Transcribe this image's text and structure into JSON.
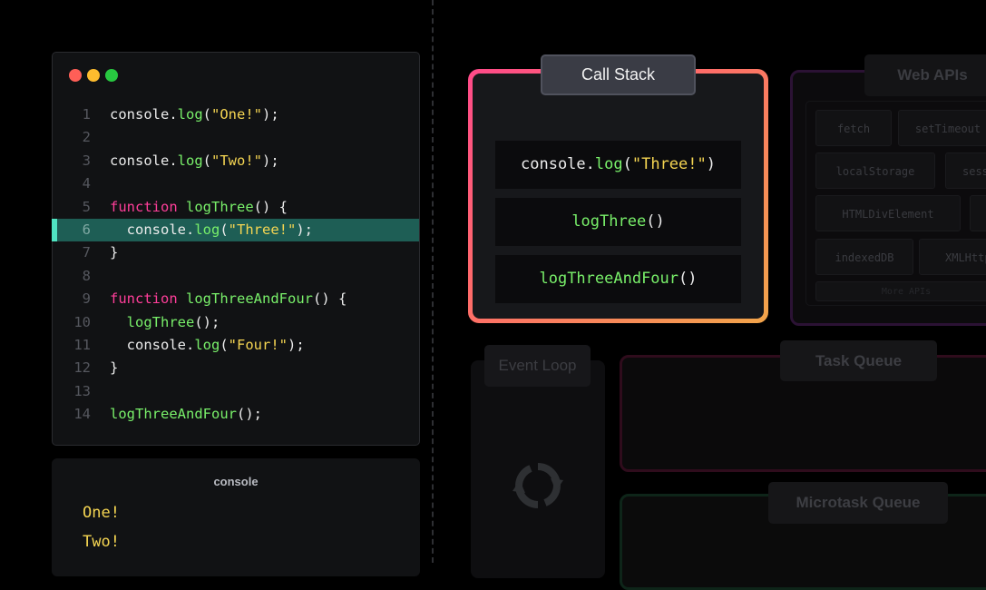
{
  "editor": {
    "lines": [
      {
        "num": "1",
        "tokens": [
          {
            "t": "console.",
            "c": "pn"
          },
          {
            "t": "log",
            "c": "fn"
          },
          {
            "t": "(",
            "c": "pn"
          },
          {
            "t": "\"One!\"",
            "c": "str"
          },
          {
            "t": ");",
            "c": "pn"
          }
        ]
      },
      {
        "num": "2",
        "tokens": []
      },
      {
        "num": "3",
        "tokens": [
          {
            "t": "console.",
            "c": "pn"
          },
          {
            "t": "log",
            "c": "fn"
          },
          {
            "t": "(",
            "c": "pn"
          },
          {
            "t": "\"Two!\"",
            "c": "str"
          },
          {
            "t": ");",
            "c": "pn"
          }
        ]
      },
      {
        "num": "4",
        "tokens": []
      },
      {
        "num": "5",
        "tokens": [
          {
            "t": "function",
            "c": "kw"
          },
          {
            "t": " ",
            "c": "pn"
          },
          {
            "t": "logThree",
            "c": "fn"
          },
          {
            "t": "() {",
            "c": "pn"
          }
        ]
      },
      {
        "num": "6",
        "highlight": true,
        "tokens": [
          {
            "t": "  console.",
            "c": "pn"
          },
          {
            "t": "log",
            "c": "fn"
          },
          {
            "t": "(",
            "c": "pn"
          },
          {
            "t": "\"Three!\"",
            "c": "str"
          },
          {
            "t": ");",
            "c": "pn"
          }
        ]
      },
      {
        "num": "7",
        "tokens": [
          {
            "t": "}",
            "c": "pn"
          }
        ]
      },
      {
        "num": "8",
        "tokens": []
      },
      {
        "num": "9",
        "tokens": [
          {
            "t": "function",
            "c": "kw"
          },
          {
            "t": " ",
            "c": "pn"
          },
          {
            "t": "logThreeAndFour",
            "c": "fn"
          },
          {
            "t": "() {",
            "c": "pn"
          }
        ]
      },
      {
        "num": "10",
        "tokens": [
          {
            "t": "  ",
            "c": "pn"
          },
          {
            "t": "logThree",
            "c": "fn"
          },
          {
            "t": "();",
            "c": "pn"
          }
        ]
      },
      {
        "num": "11",
        "tokens": [
          {
            "t": "  console.",
            "c": "pn"
          },
          {
            "t": "log",
            "c": "fn"
          },
          {
            "t": "(",
            "c": "pn"
          },
          {
            "t": "\"Four!\"",
            "c": "str"
          },
          {
            "t": ");",
            "c": "pn"
          }
        ]
      },
      {
        "num": "12",
        "tokens": [
          {
            "t": "}",
            "c": "pn"
          }
        ]
      },
      {
        "num": "13",
        "tokens": []
      },
      {
        "num": "14",
        "tokens": [
          {
            "t": "logThreeAndFour",
            "c": "fn"
          },
          {
            "t": "();",
            "c": "pn"
          }
        ]
      }
    ]
  },
  "console": {
    "title": "console",
    "outputs": [
      "One!",
      "Two!"
    ]
  },
  "call_stack": {
    "title": "Call Stack",
    "frames": [
      [
        {
          "t": "console.",
          "c": "pn"
        },
        {
          "t": "log",
          "c": "fn"
        },
        {
          "t": "(",
          "c": "pn"
        },
        {
          "t": "\"Three!\"",
          "c": "str"
        },
        {
          "t": ")",
          "c": "pn"
        }
      ],
      [
        {
          "t": "logThree",
          "c": "fn"
        },
        {
          "t": "()",
          "c": "pn"
        }
      ],
      [
        {
          "t": "logThreeAndFour",
          "c": "fn"
        },
        {
          "t": "()",
          "c": "pn"
        }
      ]
    ]
  },
  "web_apis": {
    "title": "Web APIs",
    "items": [
      "fetch",
      "setTimeout",
      "localStorage",
      "sessionStorage",
      "HTMLDivElement",
      "indexedDB",
      "XMLHttpRequest",
      "More APIs"
    ]
  },
  "event_loop": {
    "title": "Event Loop"
  },
  "task_queue": {
    "title": "Task Queue"
  },
  "microtask_queue": {
    "title": "Microtask Queue"
  },
  "colors": {
    "keyword": "#ff3e9a",
    "function": "#79f06a",
    "string": "#f5d552",
    "highlight": "#1e5e55"
  }
}
